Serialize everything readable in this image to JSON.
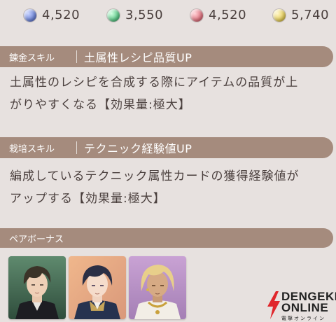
{
  "colors": {
    "background": "#e7e1df",
    "header": "#a58b7d",
    "text": "#4a3f3d",
    "gem_blue": "#6f86d8",
    "gem_green": "#5fc98a",
    "gem_red": "#e27783",
    "gem_yellow": "#e6cf5e"
  },
  "stats": [
    {
      "icon": "blue-gem-icon",
      "value": "4,520"
    },
    {
      "icon": "green-gem-icon",
      "value": "3,550"
    },
    {
      "icon": "red-gem-icon",
      "value": "4,520"
    },
    {
      "icon": "yellow-gem-icon",
      "value": "5,740"
    }
  ],
  "skills": [
    {
      "type": "錬金スキル",
      "name": "土属性レシピ品質UP",
      "desc_lines": [
        "土属性のレシピを合成する際にアイテムの品質が上",
        "がりやすくなる【効果量:極大】"
      ]
    },
    {
      "type": "栽培スキル",
      "name": "テクニック経験値UP",
      "desc_lines": [
        "編成しているテクニック属性カードの獲得経験値が",
        "アップする【効果量:極大】"
      ]
    }
  ],
  "pair_bonus": {
    "title": "ペアボーナス",
    "portraits": [
      "dark-haired-character-portrait",
      "navy-haired-character-portrait",
      "blonde-character-portrait"
    ]
  },
  "logo": {
    "line1": "DENGEKI",
    "line2": "ONLINE",
    "line3": "電撃オンライン"
  }
}
